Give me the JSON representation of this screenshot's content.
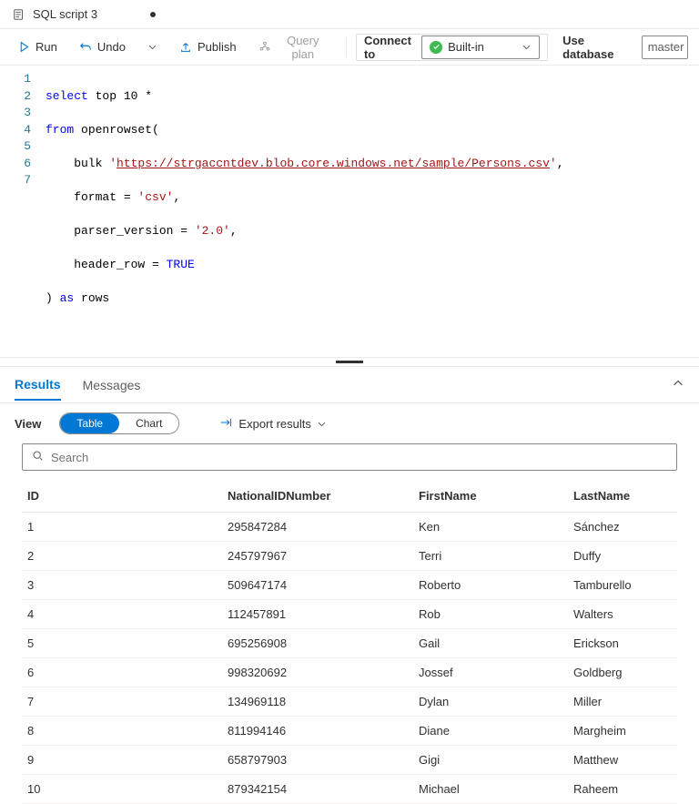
{
  "tab": {
    "title": "SQL script 3",
    "dirty": true
  },
  "toolbar": {
    "run": "Run",
    "undo": "Undo",
    "publish": "Publish",
    "query_plan": "Query plan",
    "connect_to": "Connect to",
    "connection": "Built-in",
    "use_database": "Use database",
    "database": "master"
  },
  "editor": {
    "lines": [
      "1",
      "2",
      "3",
      "4",
      "5",
      "6",
      "7"
    ],
    "code": {
      "l1_a": "select",
      "l1_b": " top ",
      "l1_c": "10",
      "l1_d": " *",
      "l2_a": "from",
      "l2_b": " openrowset(",
      "l3_a": "    bulk ",
      "l3_b": "'",
      "l3_c": "https://strgaccntdev.blob.core.windows.net/sample/Persons.csv",
      "l3_d": "'",
      "l3_e": ",",
      "l4_a": "    format = ",
      "l4_b": "'csv'",
      "l4_c": ",",
      "l5_a": "    parser_version = ",
      "l5_b": "'2.0'",
      "l5_c": ",",
      "l6_a": "    header_row = ",
      "l6_b": "TRUE",
      "l7_a": ") ",
      "l7_b": "as",
      "l7_c": " rows"
    }
  },
  "results_tabs": {
    "results": "Results",
    "messages": "Messages"
  },
  "view": {
    "label": "View",
    "table": "Table",
    "chart": "Chart",
    "export": "Export results"
  },
  "search": {
    "placeholder": "Search"
  },
  "columns": {
    "c1": "ID",
    "c2": "NationalIDNumber",
    "c3": "FirstName",
    "c4": "LastName"
  },
  "rows": [
    {
      "id": "1",
      "nid": "295847284",
      "fn": "Ken",
      "ln": "Sánchez"
    },
    {
      "id": "2",
      "nid": "245797967",
      "fn": "Terri",
      "ln": "Duffy"
    },
    {
      "id": "3",
      "nid": "509647174",
      "fn": "Roberto",
      "ln": "Tamburello"
    },
    {
      "id": "4",
      "nid": "112457891",
      "fn": "Rob",
      "ln": "Walters"
    },
    {
      "id": "5",
      "nid": "695256908",
      "fn": "Gail",
      "ln": "Erickson"
    },
    {
      "id": "6",
      "nid": "998320692",
      "fn": "Jossef",
      "ln": "Goldberg"
    },
    {
      "id": "7",
      "nid": "134969118",
      "fn": "Dylan",
      "ln": "Miller"
    },
    {
      "id": "8",
      "nid": "811994146",
      "fn": "Diane",
      "ln": "Margheim"
    },
    {
      "id": "9",
      "nid": "658797903",
      "fn": "Gigi",
      "ln": "Matthew"
    },
    {
      "id": "10",
      "nid": "879342154",
      "fn": "Michael",
      "ln": "Raheem"
    }
  ]
}
